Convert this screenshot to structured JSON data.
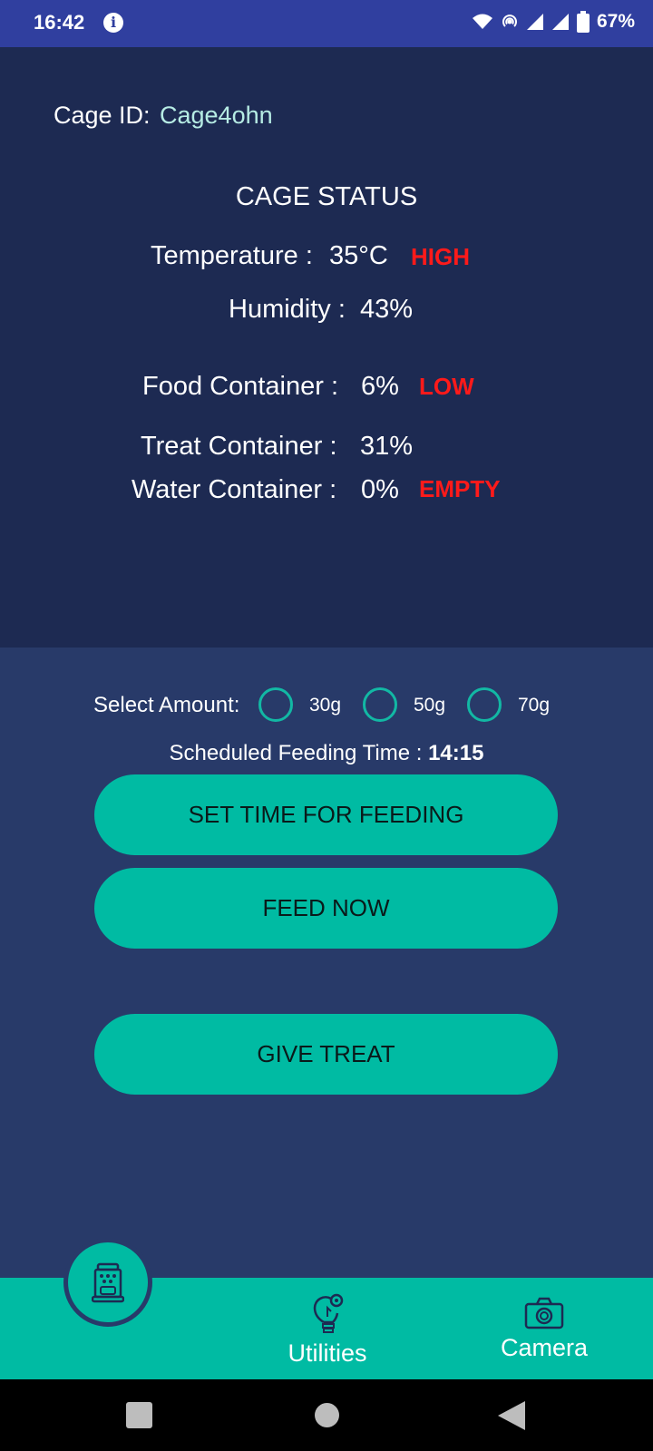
{
  "status_bar": {
    "time": "16:42",
    "battery_percent": "67%",
    "icons": [
      "info-icon",
      "wifi-icon",
      "hotspot-icon",
      "signal-icon",
      "signal-icon",
      "battery-icon"
    ]
  },
  "cage": {
    "id_label": "Cage ID:",
    "id_value": "Cage4ohn",
    "status_title": "CAGE STATUS",
    "rows": {
      "temperature": {
        "label": "Temperature :",
        "value": "35°C",
        "alert": "HIGH"
      },
      "humidity": {
        "label": "Humidity :",
        "value": "43%"
      },
      "food": {
        "label": "Food Container :",
        "value": "6%",
        "alert": "LOW"
      },
      "treat": {
        "label": "Treat Container :",
        "value": "31%"
      },
      "water": {
        "label": "Water Container :",
        "value": "0%",
        "alert": "EMPTY"
      }
    }
  },
  "feeding": {
    "select_label": "Select Amount:",
    "options": [
      "30g",
      "50g",
      "70g"
    ],
    "selected_option": null,
    "scheduled_label": "Scheduled Feeding Time :",
    "scheduled_time": "14:15",
    "set_time_button": "SET TIME FOR FEEDING",
    "feed_now_button": "FEED NOW",
    "give_treat_button": "GIVE TREAT"
  },
  "bottom_nav": {
    "home_icon": "feeder-icon",
    "items": [
      {
        "label": "Utilities",
        "icon": "lightbulb-gear-icon"
      },
      {
        "label": "Camera",
        "icon": "camera-icon"
      }
    ]
  },
  "colors": {
    "status_bar": "#303f9f",
    "top_panel": "#1d2a52",
    "bottom_panel": "#283a69",
    "accent": "#00bba3",
    "alert": "#ff1a1a",
    "cage_id_value": "#b6ece4"
  }
}
